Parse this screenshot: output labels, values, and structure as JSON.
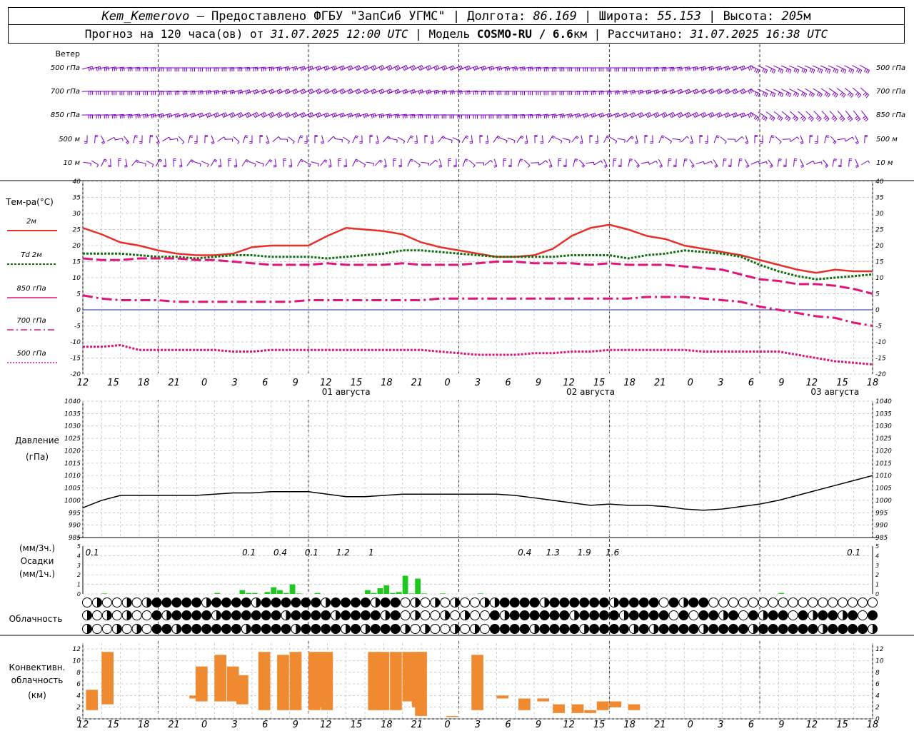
{
  "header": {
    "station": "Kem_Kemerovo",
    "provider": "— Предоставлено ФГБУ \"ЗапСиб УГМС\"",
    "lon_label": "Долгота:",
    "lon": "86.169",
    "lat_label": "Широта:",
    "lat": "55.153",
    "alt_label": "Высота:",
    "alt": "205",
    "alt_unit": "м",
    "forecast_prefix": "Прогноз на 120 часа(ов) от",
    "forecast_start": "31.07.2025 12:00 UTC",
    "model_label": "Модель",
    "model": "COSMO-RU / 6.6",
    "model_unit": "км",
    "calc_label": "Рассчитано:",
    "calc_time": "31.07.2025 16:38 UTC"
  },
  "wind": {
    "title": "Ветер",
    "levels": [
      "500 гПа",
      "700 гПа",
      "850 гПа",
      "500 м",
      "10 м"
    ],
    "color": "#7b00c8"
  },
  "temp": {
    "title": "Тем-ра(°С)",
    "legend": [
      "2м",
      "Td 2м",
      "850 гПа",
      "700 гПа",
      "500 гПа"
    ],
    "ticks": [
      "40",
      "35",
      "30",
      "25",
      "20",
      "15",
      "10",
      "5",
      "0",
      "-5",
      "-10",
      "-15",
      "-20"
    ]
  },
  "time_axis": {
    "labels": [
      "12",
      "15",
      "18",
      "21",
      "0",
      "3",
      "6",
      "9",
      "12",
      "15",
      "18",
      "21",
      "0",
      "3",
      "6",
      "9",
      "12",
      "15",
      "18",
      "21",
      "0",
      "3",
      "6",
      "9",
      "12",
      "15",
      "18"
    ],
    "dates": [
      "01 августа",
      "02 августа",
      "03 августа"
    ]
  },
  "pressure": {
    "title1": "Давление",
    "title2": "(гПа)",
    "ticks": [
      "1040",
      "1035",
      "1030",
      "1025",
      "1020",
      "1015",
      "1010",
      "1005",
      "1000",
      "995",
      "990",
      "985"
    ]
  },
  "precip": {
    "title1": "(мм/3ч.)",
    "title2": "Осадки",
    "title3": "(мм/1ч.)",
    "ticks": [
      "5",
      "4",
      "3",
      "2",
      "1",
      "0"
    ],
    "labels": [
      "0.1",
      "0.1",
      "0.4",
      "0.1",
      "1.2",
      "1",
      "0.4",
      "1.3",
      "1.9",
      "1.6",
      "0.1"
    ]
  },
  "cloud": {
    "title": "Облачность"
  },
  "conv": {
    "title1": "Конвективн.",
    "title2": "облачность",
    "title3": "(км)",
    "ticks": [
      "12",
      "10",
      "8",
      "6",
      "4",
      "2",
      "0"
    ]
  },
  "colors": {
    "t2m": "#e8302a",
    "td2m": "#107010",
    "t850": "#e0147a",
    "t700": "#e0147a",
    "t500": "#e0147a",
    "precip": "#1ec81e",
    "conv": "#f08a30",
    "zero_line": "#2020d0"
  },
  "chart_data": [
    {
      "type": "line",
      "title": "Тем-ра(°С)",
      "ylim": [
        -20,
        40
      ],
      "x_hours": [
        0,
        3,
        6,
        9,
        12,
        15,
        18,
        21,
        24,
        27,
        30,
        33,
        36,
        39,
        42,
        45,
        48,
        51,
        54,
        57,
        60,
        63,
        66,
        69,
        72,
        75,
        78,
        81,
        84,
        87,
        90,
        93,
        96,
        99,
        102,
        105,
        108,
        111,
        114,
        117,
        120,
        123,
        126
      ],
      "series": [
        {
          "name": "2м",
          "values": [
            25.5,
            23.5,
            21,
            20,
            18.5,
            17.5,
            17,
            17,
            17.5,
            19.5,
            20,
            20,
            20,
            23,
            25.5,
            25,
            24.5,
            23.5,
            21,
            19.5,
            18.5,
            17.5,
            16.5,
            16.5,
            17,
            19,
            23,
            25.5,
            26.5,
            25,
            23,
            22,
            20,
            19,
            18,
            17,
            15.5,
            14,
            12.5,
            11.5,
            12.5,
            12,
            12
          ]
        },
        {
          "name": "Td 2м",
          "values": [
            17.5,
            17.5,
            17.5,
            17,
            16.5,
            16.5,
            16,
            16.5,
            17,
            17,
            16.5,
            16.5,
            16.5,
            16,
            16.5,
            17,
            17.5,
            18.5,
            18.5,
            18,
            17.5,
            17,
            16.5,
            16.5,
            16.5,
            16.5,
            17,
            17,
            17,
            16,
            17,
            17.5,
            18.5,
            18,
            17.5,
            16.5,
            14,
            12,
            10.5,
            9.5,
            10,
            10.5,
            11
          ]
        },
        {
          "name": "850 гПа",
          "values": [
            16,
            15.5,
            15.5,
            16,
            16,
            16,
            15.5,
            15.5,
            15,
            14.5,
            14,
            14,
            14,
            14.5,
            14,
            14,
            14,
            14.5,
            14,
            14,
            14,
            14.5,
            15,
            15,
            14.5,
            14.5,
            14.5,
            14,
            14.5,
            14,
            14,
            14,
            13.5,
            13,
            12.5,
            11,
            9.5,
            9,
            8,
            8,
            7.5,
            6.5,
            5
          ]
        },
        {
          "name": "700 гПа",
          "values": [
            4.5,
            3.5,
            3,
            3,
            3,
            2.5,
            2.5,
            2.5,
            2.5,
            2.5,
            2.5,
            2.5,
            3,
            3,
            3,
            3,
            3,
            3,
            3,
            3.5,
            3.5,
            3.5,
            3.5,
            3.5,
            3.5,
            3.5,
            3.5,
            3.5,
            3.5,
            3.5,
            4,
            4,
            4,
            3.5,
            3,
            2.5,
            1,
            0,
            -1,
            -2,
            -2.5,
            -4,
            -5
          ]
        },
        {
          "name": "500 гПа",
          "values": [
            -11.5,
            -11.5,
            -11,
            -12.5,
            -12.5,
            -12.5,
            -12.5,
            -12.5,
            -13,
            -13,
            -12.5,
            -12.5,
            -12.5,
            -12.5,
            -12.5,
            -12.5,
            -12.5,
            -12.5,
            -12.5,
            -13,
            -13.5,
            -14,
            -14,
            -14,
            -13.5,
            -13.5,
            -13,
            -13,
            -12.5,
            -12.5,
            -12.5,
            -12.5,
            -12.5,
            -13,
            -13,
            -13,
            -13,
            -13,
            -14,
            -15,
            -16,
            -16.5,
            -17
          ]
        }
      ]
    },
    {
      "type": "line",
      "title": "Давление (гПа)",
      "ylim": [
        985,
        1040
      ],
      "x_hours": [
        0,
        3,
        6,
        9,
        12,
        15,
        18,
        21,
        24,
        27,
        30,
        33,
        36,
        39,
        42,
        45,
        48,
        51,
        54,
        57,
        60,
        63,
        66,
        69,
        72,
        75,
        78,
        81,
        84,
        87,
        90,
        93,
        96,
        99,
        102,
        105,
        108,
        111,
        114,
        117,
        120,
        123,
        126
      ],
      "series": [
        {
          "name": "Давление",
          "values": [
            997,
            1000,
            1002,
            1002,
            1002,
            1002,
            1002,
            1002.5,
            1003,
            1003,
            1003.5,
            1003.5,
            1003.5,
            1002.5,
            1001.5,
            1001.5,
            1002,
            1002.5,
            1002.5,
            1002.5,
            1002.5,
            1002.5,
            1002.5,
            1002,
            1001,
            1000,
            999,
            998,
            998.5,
            998,
            998,
            997.5,
            996.5,
            996,
            996.5,
            997.5,
            998.5,
            1000,
            1002,
            1004,
            1006,
            1008,
            1010
          ]
        }
      ]
    },
    {
      "type": "bar",
      "title": "Осадки (мм/1ч.)",
      "ylim": [
        0,
        5
      ],
      "x_hours": [
        3,
        21,
        25,
        26,
        27,
        29,
        30,
        31,
        32,
        33,
        34,
        37,
        45,
        46,
        47,
        48,
        49,
        50,
        51,
        52,
        53,
        54,
        57,
        63,
        111
      ],
      "values": [
        0.05,
        0.1,
        0.4,
        0.1,
        0.1,
        0.2,
        0.7,
        0.4,
        0.1,
        1.0,
        0.05,
        0.1,
        0.4,
        0.1,
        0.6,
        0.9,
        0.1,
        0.2,
        1.9,
        0.05,
        1.6,
        0.05,
        0.05,
        0.05,
        0.1
      ]
    },
    {
      "type": "bar",
      "title": "Конвективн. облачность (км)",
      "ylim": [
        0,
        12
      ],
      "ranges_km": [
        [
          0.5,
          1.5,
          5.0
        ],
        [
          3.0,
          2.5,
          11.5
        ],
        [
          17.0,
          3.5,
          4.0
        ],
        [
          18.0,
          3.0,
          9.0
        ],
        [
          21.0,
          3.0,
          11.0
        ],
        [
          23.0,
          3.0,
          9.0
        ],
        [
          24.5,
          2.5,
          7.5
        ],
        [
          28.0,
          1.5,
          11.5
        ],
        [
          31.0,
          1.5,
          11.0
        ],
        [
          33.0,
          1.5,
          11.5
        ],
        [
          36.0,
          1.5,
          11.5
        ],
        [
          37.0,
          2.0,
          11.5
        ],
        [
          38.0,
          1.5,
          11.5
        ],
        [
          45.5,
          1.5,
          11.5
        ],
        [
          47.0,
          1.5,
          11.5
        ],
        [
          49.0,
          1.5,
          11.5
        ],
        [
          51.0,
          3.0,
          11.5
        ],
        [
          52.5,
          2.0,
          11.5
        ],
        [
          53.0,
          0.5,
          11.5
        ],
        [
          58.0,
          0.5,
          0.5
        ],
        [
          62.0,
          1.5,
          11.0
        ],
        [
          66.0,
          3.5,
          4.0
        ],
        [
          69.5,
          1.5,
          3.5
        ],
        [
          72.5,
          3.0,
          3.5
        ],
        [
          75.0,
          1.0,
          2.5
        ],
        [
          78.0,
          1.0,
          2.5
        ],
        [
          80.0,
          1.0,
          1.5
        ],
        [
          82.0,
          1.5,
          3.0
        ],
        [
          84.0,
          2.0,
          3.0
        ],
        [
          87.0,
          1.5,
          2.5
        ]
      ]
    }
  ]
}
